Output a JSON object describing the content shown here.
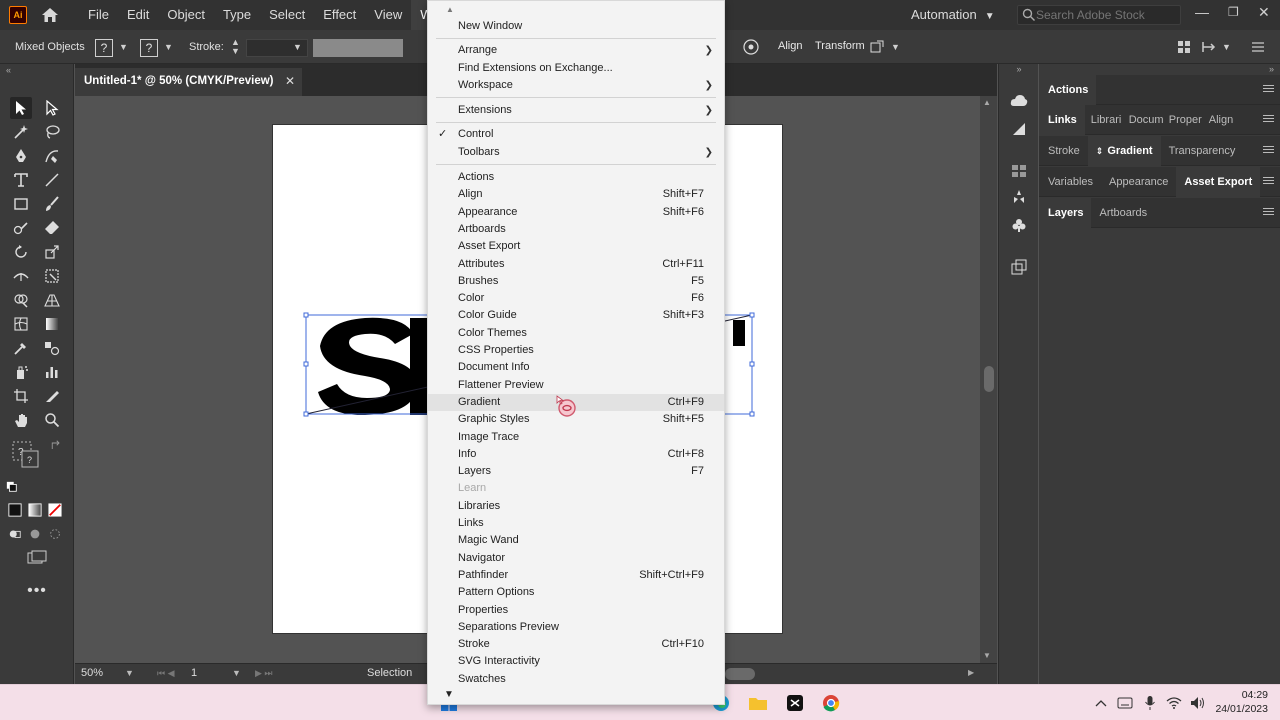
{
  "app": {
    "logo": "Ai"
  },
  "menubar": {
    "items": [
      "File",
      "Edit",
      "Object",
      "Type",
      "Select",
      "Effect",
      "View",
      "Window"
    ],
    "workspace": "Automation",
    "search_placeholder": "Search Adobe Stock"
  },
  "control": {
    "selection": "Mixed Objects",
    "fill_q": "?",
    "stroke_q": "?",
    "stroke_label": "Stroke:",
    "align": "Align",
    "transform": "Transform"
  },
  "document": {
    "tab_title": "Untitled-1* @ 50% (CMYK/Preview)",
    "close": "✕"
  },
  "status": {
    "zoom": "50%",
    "page": "1",
    "mode": "Selection"
  },
  "panels": {
    "row1": [
      "Actions"
    ],
    "row2": [
      "Links",
      "Librari",
      "Docum",
      "Proper",
      "Align"
    ],
    "row3": [
      "Stroke",
      "Gradient",
      "Transparency"
    ],
    "row4": [
      "Variables",
      "Appearance",
      "Asset Export"
    ],
    "row5": [
      "Layers",
      "Artboards"
    ]
  },
  "window_menu": {
    "new_window": "New Window",
    "arrange": "Arrange",
    "find_ext": "Find Extensions on Exchange...",
    "workspace": "Workspace",
    "extensions": "Extensions",
    "control": "Control",
    "control_check": "✓",
    "toolbars": "Toolbars",
    "items": [
      {
        "label": "Actions",
        "shortcut": ""
      },
      {
        "label": "Align",
        "shortcut": "Shift+F7"
      },
      {
        "label": "Appearance",
        "shortcut": "Shift+F6"
      },
      {
        "label": "Artboards",
        "shortcut": ""
      },
      {
        "label": "Asset Export",
        "shortcut": ""
      },
      {
        "label": "Attributes",
        "shortcut": "Ctrl+F11"
      },
      {
        "label": "Brushes",
        "shortcut": "F5"
      },
      {
        "label": "Color",
        "shortcut": "F6"
      },
      {
        "label": "Color Guide",
        "shortcut": "Shift+F3"
      },
      {
        "label": "Color Themes",
        "shortcut": ""
      },
      {
        "label": "CSS Properties",
        "shortcut": ""
      },
      {
        "label": "Document Info",
        "shortcut": ""
      },
      {
        "label": "Flattener Preview",
        "shortcut": ""
      },
      {
        "label": "Gradient",
        "shortcut": "Ctrl+F9"
      },
      {
        "label": "Graphic Styles",
        "shortcut": "Shift+F5"
      },
      {
        "label": "Image Trace",
        "shortcut": ""
      },
      {
        "label": "Info",
        "shortcut": "Ctrl+F8"
      },
      {
        "label": "Layers",
        "shortcut": "F7"
      },
      {
        "label": "Learn",
        "shortcut": ""
      },
      {
        "label": "Libraries",
        "shortcut": ""
      },
      {
        "label": "Links",
        "shortcut": ""
      },
      {
        "label": "Magic Wand",
        "shortcut": ""
      },
      {
        "label": "Navigator",
        "shortcut": ""
      },
      {
        "label": "Pathfinder",
        "shortcut": "Shift+Ctrl+F9"
      },
      {
        "label": "Pattern Options",
        "shortcut": ""
      },
      {
        "label": "Properties",
        "shortcut": ""
      },
      {
        "label": "Separations Preview",
        "shortcut": ""
      },
      {
        "label": "Stroke",
        "shortcut": "Ctrl+F10"
      },
      {
        "label": "SVG Interactivity",
        "shortcut": ""
      },
      {
        "label": "Swatches",
        "shortcut": ""
      }
    ]
  },
  "taskbar": {
    "time": "04:29",
    "date": "24/01/2023"
  },
  "colors": {
    "accent": "#ff9a00",
    "menu_bg": "#f3f3f3",
    "highlight": "#e2e2e2"
  }
}
